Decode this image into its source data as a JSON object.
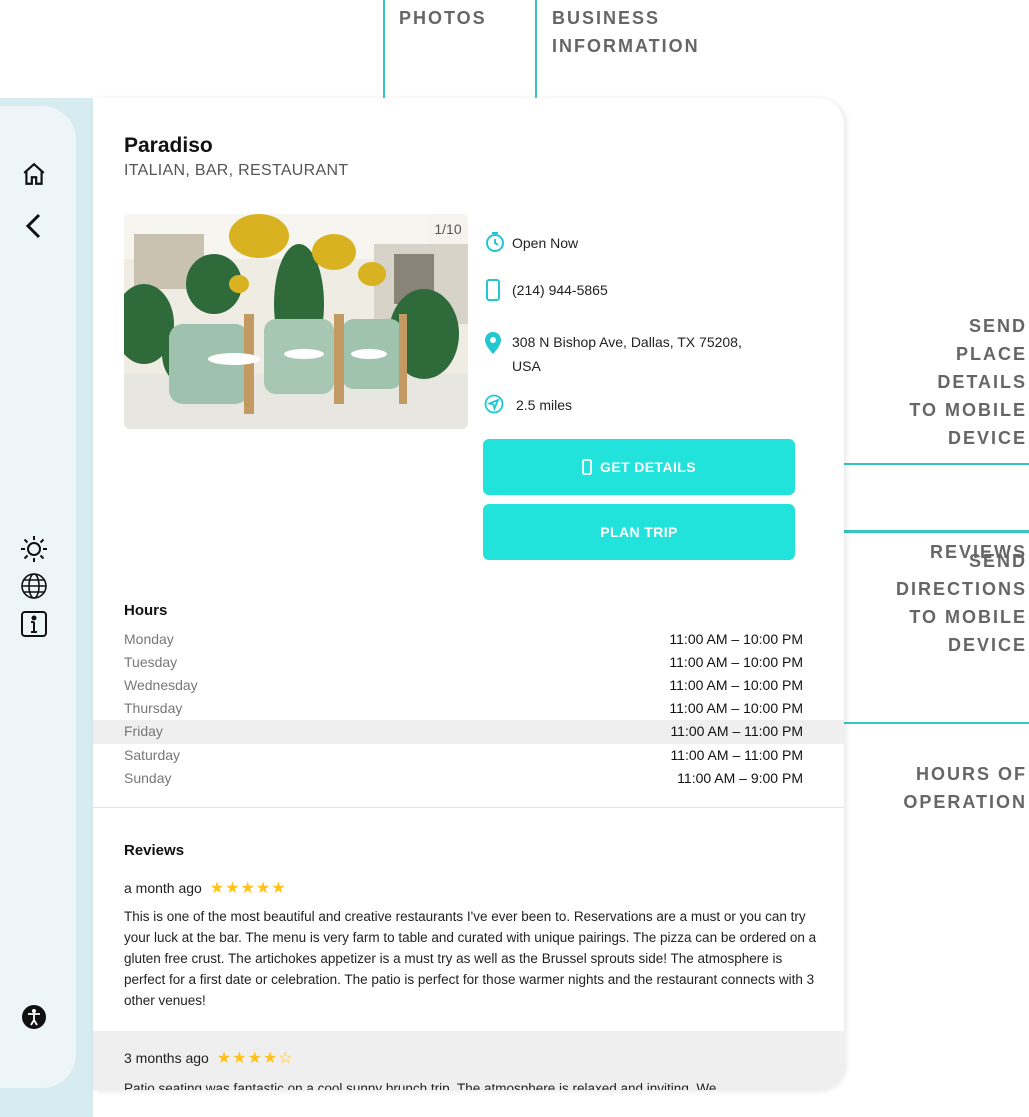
{
  "annotations": {
    "photos": "PHOTOS",
    "business_line1": "BUSINESS",
    "business_line2": "INFORMATION",
    "send_place": [
      "SEND",
      "PLACE",
      "DETAILS",
      "TO MOBILE",
      "DEVICE"
    ],
    "send_directions": [
      "SEND",
      "DIRECTIONS",
      "TO MOBILE",
      "DEVICE"
    ],
    "hours_of_operation": [
      "HOURS OF",
      "OPERATION"
    ],
    "reviews": "REVIEWS"
  },
  "place": {
    "name": "Paradiso",
    "categories": "ITALIAN, BAR, RESTAURANT",
    "photo_counter": "1/10",
    "status": "Open Now",
    "phone": "(214) 944-5865",
    "address_line1": "308 N Bishop Ave, Dallas, TX 75208,",
    "address_line2": "USA",
    "distance": "2.5 miles"
  },
  "actions": {
    "get_details": "GET DETAILS",
    "plan_trip": "PLAN TRIP"
  },
  "hours": {
    "title": "Hours",
    "rows": [
      {
        "day": "Monday",
        "time": "11:00 AM – 10:00 PM"
      },
      {
        "day": "Tuesday",
        "time": "11:00 AM – 10:00 PM"
      },
      {
        "day": "Wednesday",
        "time": "11:00 AM – 10:00 PM"
      },
      {
        "day": "Thursday",
        "time": "11:00 AM – 10:00 PM"
      },
      {
        "day": "Friday",
        "time": "11:00 AM – 11:00 PM"
      },
      {
        "day": "Saturday",
        "time": "11:00 AM – 11:00 PM"
      },
      {
        "day": "Sunday",
        "time": "11:00 AM – 9:00 PM"
      }
    ],
    "highlighted_day": "Friday"
  },
  "reviews": {
    "title": "Reviews",
    "items": [
      {
        "when": "a month ago",
        "stars": "★★★★★",
        "text": "This is one of the most beautiful and creative restaurants I've ever been to. Reservations are a must or you can try your luck at the bar. The menu is very farm to table and curated with unique pairings. The pizza can be ordered on a gluten free crust. The artichokes appetizer is a must try as well as the Brussel sprouts side! The atmosphere is perfect for a first date or celebration. The patio is perfect for those warmer nights and the restaurant connects with 3 other venues!"
      },
      {
        "when": "3 months ago",
        "stars": "★★★★",
        "stars_empty": "☆",
        "text": "Patio seating was fantastic on a cool sunny brunch trip. The atmosphere is relaxed and inviting. We"
      }
    ]
  },
  "colors": {
    "accent": "#22e3db",
    "annotation_line": "#36c7c3",
    "star": "#ffc21a",
    "rail": "#d6ecf0"
  },
  "icons": {
    "home": "home-icon",
    "back": "chevron-left-icon",
    "brightness": "sun-icon",
    "language": "globe-icon",
    "info": "info-icon",
    "accessibility": "accessibility-icon",
    "clock": "clock-icon",
    "phone": "phone-icon",
    "location": "map-pin-icon",
    "distance": "navigation-icon"
  }
}
